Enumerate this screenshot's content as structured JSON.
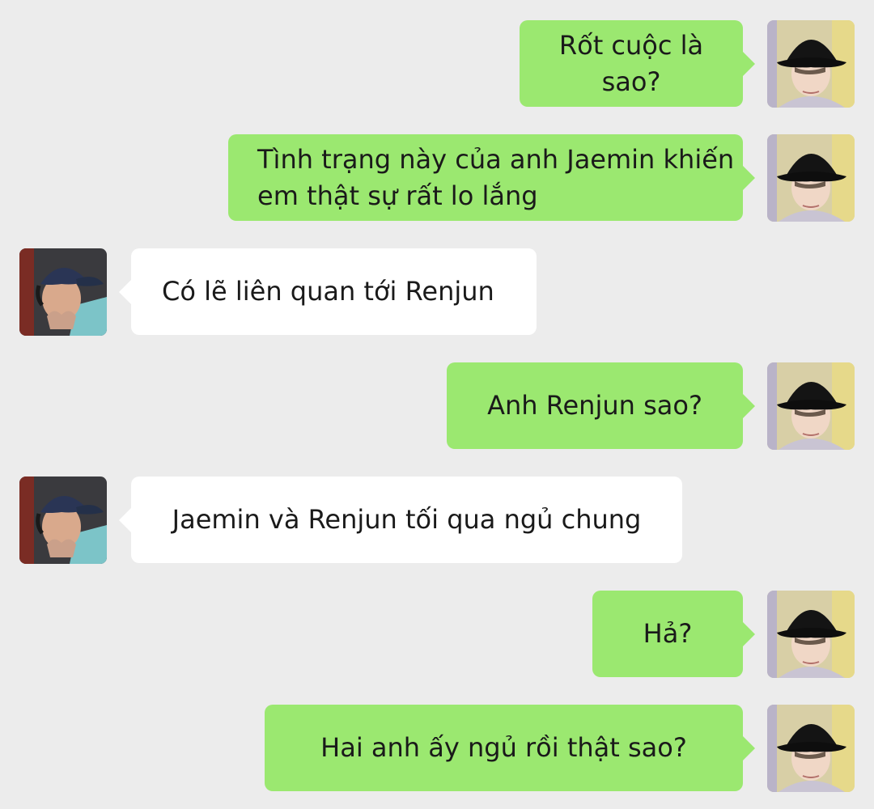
{
  "colors": {
    "background": "#ececec",
    "outgoing_bubble": "#9be870",
    "incoming_bubble": "#ffffff"
  },
  "messages": [
    {
      "side": "outgoing",
      "avatar": "user-avatar-bucket-hat",
      "text": "Rốt cuộc là sao?"
    },
    {
      "side": "outgoing",
      "avatar": "user-avatar-bucket-hat",
      "text": "Tình trạng này của anh Jaemin khiến em thật sự rất lo lắng"
    },
    {
      "side": "incoming",
      "avatar": "contact-avatar-cap",
      "text": "Có lẽ liên quan tới Renjun"
    },
    {
      "side": "outgoing",
      "avatar": "user-avatar-bucket-hat",
      "text": "Anh Renjun sao?"
    },
    {
      "side": "incoming",
      "avatar": "contact-avatar-cap",
      "text": "Jaemin và Renjun tối qua ngủ chung"
    },
    {
      "side": "outgoing",
      "avatar": "user-avatar-bucket-hat",
      "text": "Hả?"
    },
    {
      "side": "outgoing",
      "avatar": "user-avatar-bucket-hat",
      "text": "Hai anh ấy ngủ rồi thật sao?"
    }
  ]
}
